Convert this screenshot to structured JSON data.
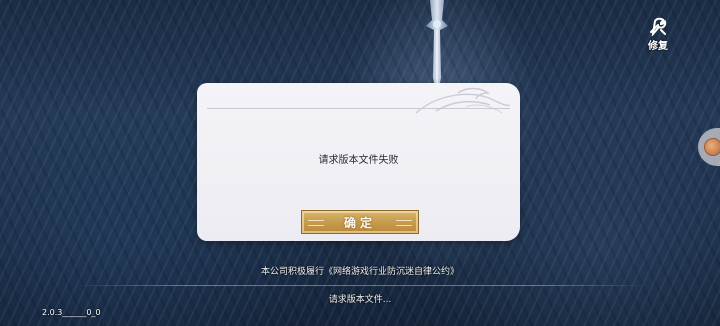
{
  "repair": {
    "icon": "repair-icon",
    "label": "修复"
  },
  "dialog": {
    "message": "请求版本文件失败",
    "confirm_label": "确定"
  },
  "footer": {
    "notice": "本公司积极履行《网络游戏行业防沉迷自律公约》",
    "status": "请求版本文件...",
    "version": "2.0.3______0_0"
  },
  "colors": {
    "dialog_bg": "#f0f0f5",
    "button_gold": "#c79c4d",
    "background": "#1f3250"
  }
}
